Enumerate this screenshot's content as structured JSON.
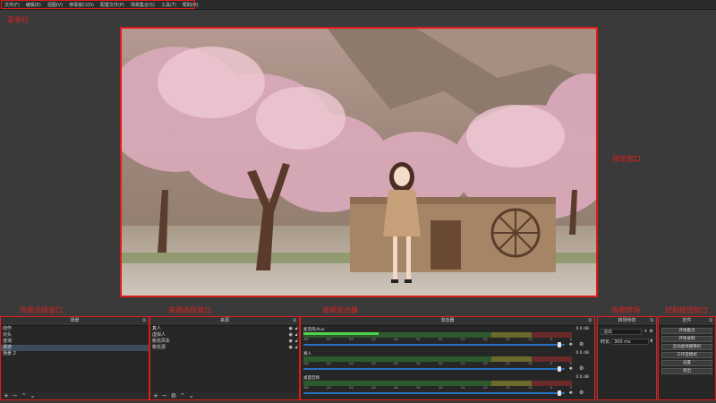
{
  "menu": {
    "items": [
      "文件(F)",
      "编辑(E)",
      "视图(V)",
      "停靠窗口(D)",
      "配置文件(P)",
      "场景集合(S)",
      "工具(T)",
      "帮助(H)"
    ]
  },
  "annotations": {
    "menubar": "菜单栏",
    "preview": "预览窗口",
    "scenes": "场景选择窗口",
    "sources": "来源选择窗口",
    "mixer": "音频混合器",
    "transitions": "场景转场",
    "controls": "控制按钮窗口"
  },
  "scenes": {
    "title": "场景",
    "items": [
      "动作",
      "对头",
      "咨询",
      "漫游",
      "场景 2"
    ],
    "selected_index": 3
  },
  "sources": {
    "title": "来源",
    "items": [
      "真人",
      "虚拟人",
      "桃花风车",
      "桃花源"
    ]
  },
  "mixer": {
    "title": "混音器",
    "scale_labels": [
      "-60",
      "-55",
      "-50",
      "-45",
      "-40",
      "-35",
      "-30",
      "-25",
      "-20",
      "-15",
      "-10",
      "-5",
      "0"
    ],
    "tracks": [
      {
        "name": "麦克风/Aux",
        "db": "0.0 dB",
        "level": 0.28,
        "fader": 0.98
      },
      {
        "name": "真人",
        "db": "0.0 dB",
        "level": 0.0,
        "fader": 0.98
      },
      {
        "name": "桌面音频",
        "db": "0.0 dB",
        "level": 0.0,
        "fader": 0.98
      }
    ]
  },
  "transitions": {
    "title": "转场特效",
    "type": "淡出",
    "duration_label": "时长",
    "duration_value": "300 ms"
  },
  "controls": {
    "title": "控件",
    "buttons": [
      "开始推流",
      "开始录制",
      "启动虚拟摄像机",
      "工作室模式",
      "设置",
      "退出"
    ]
  },
  "dock_icon": "⧉"
}
